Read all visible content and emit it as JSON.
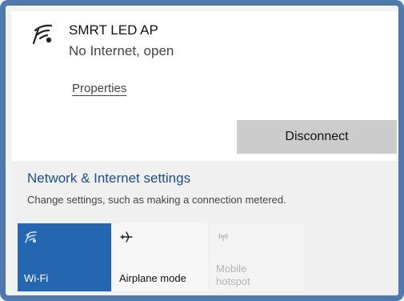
{
  "network": {
    "name": "SMRT LED AP",
    "status": "No Internet, open",
    "properties_label": "Properties",
    "disconnect_label": "Disconnect",
    "icon": "wifi-signal-icon"
  },
  "settings": {
    "link_label": "Network & Internet settings",
    "description": "Change settings, such as making a connection metered."
  },
  "quick_actions": [
    {
      "label": "Wi-Fi",
      "icon": "wifi-icon",
      "active": true
    },
    {
      "label": "Airplane mode",
      "icon": "airplane-icon",
      "active": false
    },
    {
      "label": "Mobile\nhotspot",
      "icon": "hotspot-icon",
      "active": false,
      "disabled": true
    }
  ],
  "colors": {
    "accent": "#2466b0",
    "link": "#1f4e8a",
    "frame": "#4f79ad",
    "button_bg": "#cccccc"
  }
}
